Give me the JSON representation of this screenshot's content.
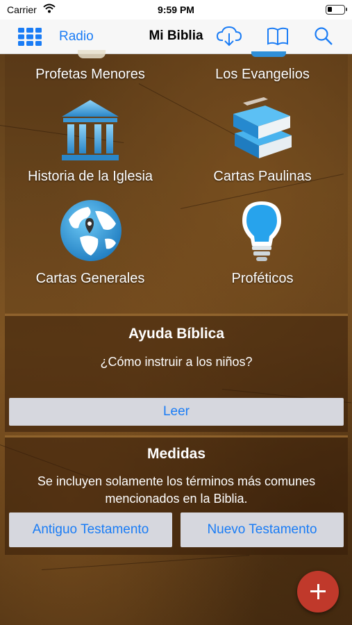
{
  "status_bar": {
    "carrier": "Carrier",
    "time": "9:59 PM"
  },
  "nav": {
    "radio_label": "Radio",
    "title": "Mi Biblia",
    "icons": [
      "grid-icon",
      "cloud-download-icon",
      "book-icon",
      "search-icon"
    ],
    "accent_color": "#1a7cf5"
  },
  "categories": [
    {
      "label": "Profetas Menores",
      "icon": "scroll-icon"
    },
    {
      "label": "Los Evangelios",
      "icon": "book-icon"
    },
    {
      "label": "Historia de la Iglesia",
      "icon": "temple-icon"
    },
    {
      "label": "Cartas Paulinas",
      "icon": "books-stack-icon"
    },
    {
      "label": "Cartas Generales",
      "icon": "globe-icon"
    },
    {
      "label": "Proféticos",
      "icon": "lightbulb-icon"
    }
  ],
  "ayuda": {
    "title": "Ayuda Bíblica",
    "question": "¿Cómo instruir a los niños?",
    "read_label": "Leer"
  },
  "medidas": {
    "title": "Medidas",
    "description_line1": "Se incluyen solamente los términos más comunes",
    "description_line2": "mencionados en la Biblia.",
    "old_testament_label": "Antiguo Testamento",
    "new_testament_label": "Nuevo Testamento"
  },
  "fab": {
    "icon": "plus-icon",
    "color": "#c0392b"
  }
}
